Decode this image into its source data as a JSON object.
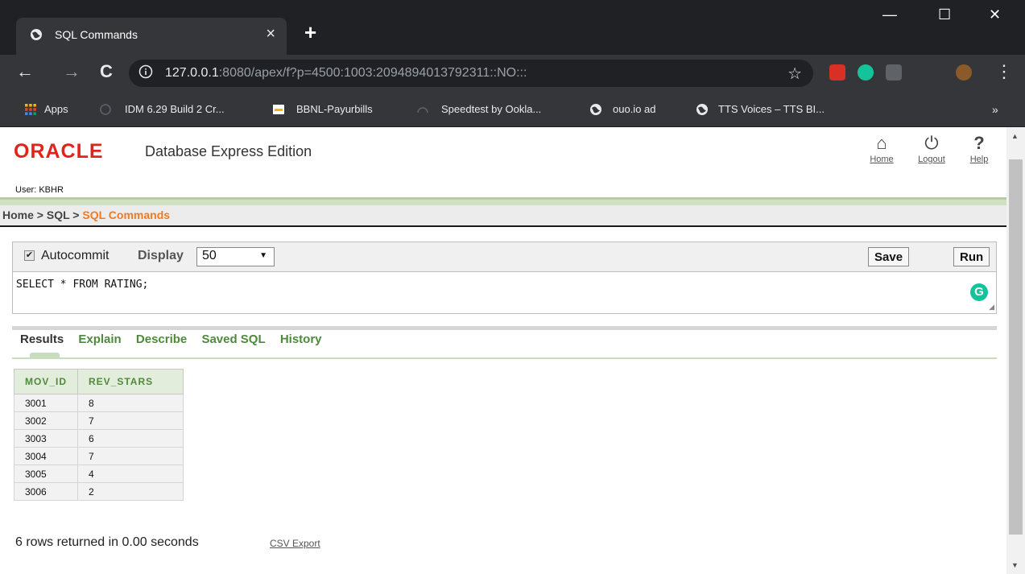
{
  "browser": {
    "tab_title": "SQL Commands",
    "tab_close": "×",
    "new_tab": "+",
    "window_controls": {
      "minimize": "—",
      "maximize": "☐",
      "close": "✕"
    },
    "nav": {
      "back": "←",
      "forward": "→",
      "reload": "C"
    },
    "url_host": "127.0.0.1",
    "url_rest": ":8080/apex/f?p=4500:1003:2094894013792311::NO:::",
    "star": "☆",
    "menu": "⋮",
    "bookmarks": [
      {
        "label": "Apps",
        "icon": "apps-grid-icon"
      },
      {
        "label": "IDM 6.29 Build 2 Cr...",
        "icon": "idm-icon"
      },
      {
        "label": "BBNL-Payurbills",
        "icon": "bbnl-icon"
      },
      {
        "label": "Speedtest by Ookla...",
        "icon": "speedtest-icon"
      },
      {
        "label": "ouo.io ad",
        "icon": "globe-icon"
      },
      {
        "label": "TTS Voices – TTS BI...",
        "icon": "globe-icon"
      }
    ],
    "bookmarks_more": "»"
  },
  "header": {
    "logo": "ORACLE",
    "edition": "Database Express Edition",
    "user": "User: KBHR",
    "icons": [
      {
        "label": "Home",
        "glyph": "⌂"
      },
      {
        "label": "Logout",
        "glyph": "⏻"
      },
      {
        "label": "Help",
        "glyph": "?"
      }
    ]
  },
  "breadcrumb": {
    "home": "Home",
    "sep": ">",
    "sql": "SQL",
    "current": "SQL Commands"
  },
  "command": {
    "autocommit_label": "Autocommit",
    "autocommit_checked": "✔",
    "display_label": "Display",
    "display_value": "50",
    "display_arrow": "▼",
    "save_label": "Save",
    "run_label": "Run",
    "sql_text": "SELECT * FROM RATING;",
    "grammarly": "G",
    "resize": "◢"
  },
  "results_tabs": [
    "Results",
    "Explain",
    "Describe",
    "Saved SQL",
    "History"
  ],
  "table": {
    "columns": [
      "MOV_ID",
      "REV_STARS"
    ],
    "rows": [
      [
        "3001",
        "8"
      ],
      [
        "3002",
        "7"
      ],
      [
        "3003",
        "6"
      ],
      [
        "3004",
        "7"
      ],
      [
        "3005",
        "4"
      ],
      [
        "3006",
        "2"
      ]
    ]
  },
  "footer": {
    "rows_message": "6 rows returned in 0.00 seconds",
    "csv_export": "CSV Export"
  },
  "colors": {
    "oracle_red": "#e2231a",
    "breadcrumb_current": "#ef7a24",
    "tab_green": "#4f8a3c",
    "grammarly_green": "#15c39a"
  }
}
